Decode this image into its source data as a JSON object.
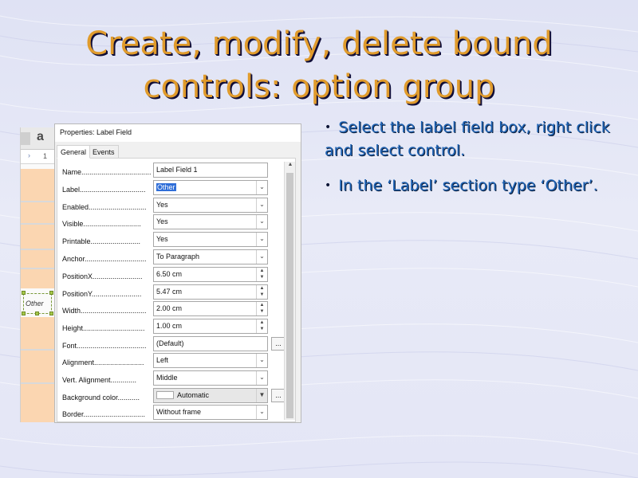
{
  "slide": {
    "title_line1": "Create, modify, delete bound",
    "title_line2": "controls: option group",
    "bullets": [
      "Select the label field box, right click and select control.",
      "In the ‘Label’ section type ‘Other’."
    ]
  },
  "document": {
    "toolbar_glyph": "a",
    "ruler_number": "1",
    "control_text": "Other"
  },
  "dialog": {
    "title": "Properties: Label Field",
    "tabs": [
      "General",
      "Events"
    ],
    "properties": [
      {
        "label": "Name",
        "value": "Label Field 1",
        "kind": "text"
      },
      {
        "label": "Label",
        "value": "Other",
        "kind": "dropdown-selected"
      },
      {
        "label": "Enabled",
        "value": "Yes",
        "kind": "dropdown"
      },
      {
        "label": "Visible",
        "value": "Yes",
        "kind": "dropdown"
      },
      {
        "label": "Printable",
        "value": "Yes",
        "kind": "dropdown"
      },
      {
        "label": "Anchor",
        "value": "To Paragraph",
        "kind": "dropdown"
      },
      {
        "label": "PositionX",
        "value": "6.50 cm",
        "kind": "spin"
      },
      {
        "label": "PositionY",
        "value": "5.47 cm",
        "kind": "spin"
      },
      {
        "label": "Width",
        "value": "2.00 cm",
        "kind": "spin"
      },
      {
        "label": "Height",
        "value": "1.00 cm",
        "kind": "spin"
      },
      {
        "label": "Font",
        "value": "(Default)",
        "kind": "text-dots"
      },
      {
        "label": "Alignment",
        "value": "Left",
        "kind": "dropdown"
      },
      {
        "label": "Vert. Alignment",
        "value": "Middle",
        "kind": "dropdown"
      },
      {
        "label": "Background color",
        "value": "Automatic",
        "kind": "color"
      },
      {
        "label": "Border",
        "value": "Without frame",
        "kind": "dropdown"
      }
    ],
    "more_button_label": "..."
  },
  "colors": {
    "title": "#e09b2c",
    "bullet_text": "#1f63b4",
    "band": "#fbd6b1",
    "selection": "#2f6ed8"
  },
  "icons": {
    "dropdown": "chevron-down-icon",
    "spinner": "spin-arrows-icon",
    "scroll_up": "chevron-up-icon"
  }
}
